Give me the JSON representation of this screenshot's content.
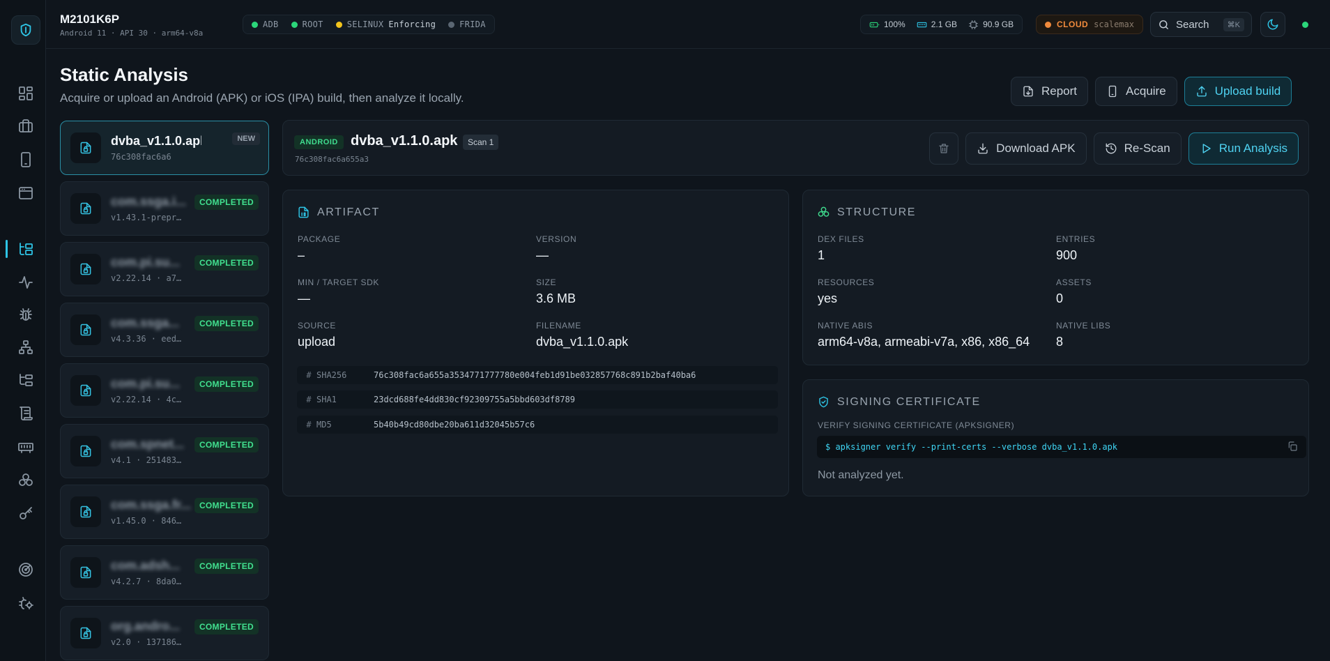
{
  "header": {
    "device_name": "M2101K6P",
    "device_sub": "Android 11 · API 30 · arm64-v8a",
    "status": [
      {
        "label": "ADB",
        "color": "#2bd67a",
        "extra": ""
      },
      {
        "label": "ROOT",
        "color": "#2bd67a",
        "extra": ""
      },
      {
        "label": "SELINUX",
        "color": "#f2c41c",
        "extra": "Enforcing"
      },
      {
        "label": "FRIDA",
        "color": "#5a6672",
        "extra": ""
      }
    ],
    "metrics": {
      "battery": "100%",
      "ram": "2.1 GB",
      "storage": "90.9 GB"
    },
    "cloud": {
      "label": "CLOUD",
      "user": "scalemax"
    },
    "search": {
      "label": "Search",
      "shortcut": "⌘K"
    }
  },
  "page": {
    "title": "Static Analysis",
    "subtitle": "Acquire or upload an Android (APK) or iOS (IPA) build, then analyze it locally."
  },
  "top_actions": {
    "report": "Report",
    "acquire": "Acquire",
    "upload": "Upload build"
  },
  "builds": [
    {
      "name": "dvba_v1.1.0.apk",
      "meta": "76c308fac6a6",
      "badge": "NEW"
    },
    {
      "name": "com.ssga.i...",
      "meta": "v1.43.1-prepr…",
      "badge": "COMPLETED"
    },
    {
      "name": "com.pi.su...",
      "meta": "v2.22.14 · a7…",
      "badge": "COMPLETED"
    },
    {
      "name": "com.ssga...",
      "meta": "v4.3.36 · eed…",
      "badge": "COMPLETED"
    },
    {
      "name": "com.pi.su...",
      "meta": "v2.22.14 · 4c…",
      "badge": "COMPLETED"
    },
    {
      "name": "com.spnet...",
      "meta": "v4.1 · 251483…",
      "badge": "COMPLETED"
    },
    {
      "name": "com.ssga.fr...",
      "meta": "v1.45.0 · 846…",
      "badge": "COMPLETED"
    },
    {
      "name": "com.adsh...",
      "meta": "v4.2.7 · 8da0…",
      "badge": "COMPLETED"
    },
    {
      "name": "org.andro...",
      "meta": "v2.0 · 137186…",
      "badge": "COMPLETED"
    }
  ],
  "selected": {
    "platform": "ANDROID",
    "name": "dvba_v1.1.0.apk",
    "scan": "Scan 1",
    "hash": "76c308fac6a655a3",
    "actions": {
      "download": "Download APK",
      "rescan": "Re-Scan",
      "run": "Run Analysis"
    }
  },
  "artifact": {
    "title": "ARTIFACT",
    "package_label": "PACKAGE",
    "package_value": "–",
    "version_label": "VERSION",
    "version_value": "—",
    "sdk_label": "MIN / TARGET SDK",
    "sdk_value": "—",
    "size_label": "SIZE",
    "size_value": "3.6 MB",
    "source_label": "SOURCE",
    "source_value": "upload",
    "filename_label": "FILENAME",
    "filename_value": "dvba_v1.1.0.apk",
    "hashes": [
      {
        "label": "SHA256",
        "value": "76c308fac6a655a3534771777780e004feb1d91be032857768c891b2baf40ba6"
      },
      {
        "label": "SHA1",
        "value": "23dcd688fe4dd830cf92309755a5bbd603df8789"
      },
      {
        "label": "MD5",
        "value": "5b40b49cd80dbe20ba611d32045b57c6"
      }
    ]
  },
  "structure": {
    "title": "STRUCTURE",
    "dex_label": "DEX FILES",
    "dex_value": "1",
    "entries_label": "ENTRIES",
    "entries_value": "900",
    "resources_label": "RESOURCES",
    "resources_value": "yes",
    "assets_label": "ASSETS",
    "assets_value": "0",
    "abis_label": "NATIVE ABIS",
    "abis_value": "arm64-v8a, armeabi-v7a, x86, x86_64",
    "libs_label": "NATIVE LIBS",
    "libs_value": "8"
  },
  "signing": {
    "title": "SIGNING CERTIFICATE",
    "verify_label": "VERIFY SIGNING CERTIFICATE (APKSIGNER)",
    "command": "$ apksigner verify --print-certs --verbose dvba_v1.1.0.apk",
    "status": "Not analyzed yet."
  }
}
